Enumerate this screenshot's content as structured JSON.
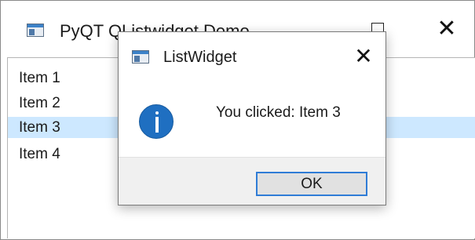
{
  "main_window": {
    "title": "PyQT QListwidget Demo",
    "maximize_icon": "maximize-icon",
    "close_icon": "close-icon",
    "close_glyph": "✕"
  },
  "list": {
    "items": [
      {
        "label": "Item 1",
        "selected": false
      },
      {
        "label": "Item 2",
        "selected": false
      },
      {
        "label": "Item 3",
        "selected": true
      },
      {
        "label": "Item 4",
        "selected": false
      }
    ],
    "selection_color": "#cde8ff"
  },
  "dialog": {
    "title": "ListWidget",
    "close_glyph": "✕",
    "icon": "info-icon",
    "message": "You clicked: Item 3",
    "ok_label": "OK",
    "accent_color": "#2f7cd6",
    "info_color": "#1f6fc1"
  }
}
